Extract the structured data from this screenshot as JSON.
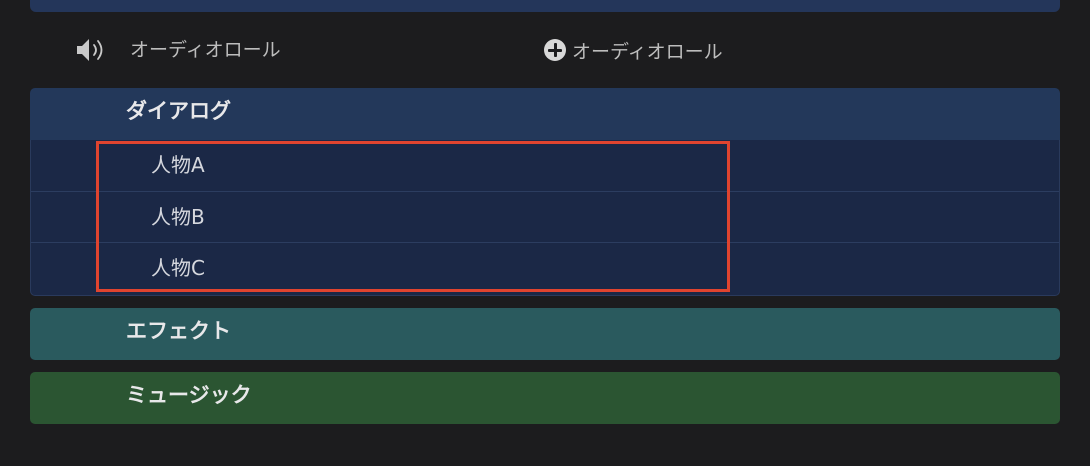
{
  "header": {
    "column_label": "オーディオロール",
    "add_role_label": "オーディオロール"
  },
  "roles": [
    {
      "label": "ダイアログ",
      "subroles": [
        {
          "label": "人物A"
        },
        {
          "label": "人物B"
        },
        {
          "label": "人物C"
        }
      ]
    },
    {
      "label": "エフェクト"
    },
    {
      "label": "ミュージック"
    }
  ],
  "icons": {
    "speaker": "speaker-icon",
    "add": "plus-circle-icon"
  },
  "colors": {
    "background": "#1c1c1e",
    "dialogue": "#23385a",
    "dialogue_subroles": "#1b2846",
    "effects": "#2a5a5e",
    "music": "#2b5532",
    "highlight": "#e0442f"
  }
}
